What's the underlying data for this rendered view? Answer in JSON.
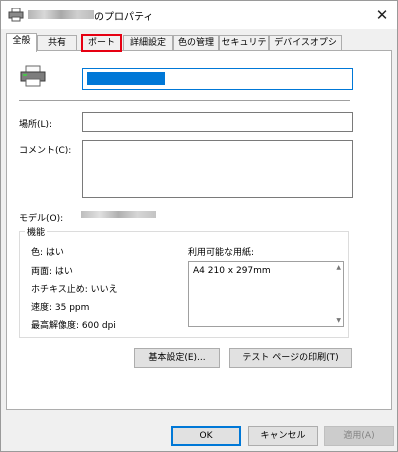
{
  "window": {
    "title_suffix": "のプロパティ",
    "close_glyph": "✕"
  },
  "tabs": [
    "全般",
    "共有",
    "ポート",
    "詳細設定",
    "色の管理",
    "セキュリティ",
    "デバイスオプション"
  ],
  "general": {
    "location_label": "場所(L):",
    "comment_label": "コメント(C):",
    "model_label": "モデル(O):",
    "features": {
      "title": "機能",
      "color": "色: はい",
      "duplex": "両面: はい",
      "staple": "ホチキス止め: いいえ",
      "speed": "速度: 35 ppm",
      "max_resolution": "最高解像度: 600 dpi",
      "paper_label": "利用可能な用紙:",
      "paper_items": [
        "A4 210 x 297mm"
      ]
    },
    "preferences_button": "基本設定(E)...",
    "test_page_button": "テスト ページの印刷(T)"
  },
  "footer": {
    "ok": "OK",
    "cancel": "キャンセル",
    "apply": "適用(A)"
  }
}
